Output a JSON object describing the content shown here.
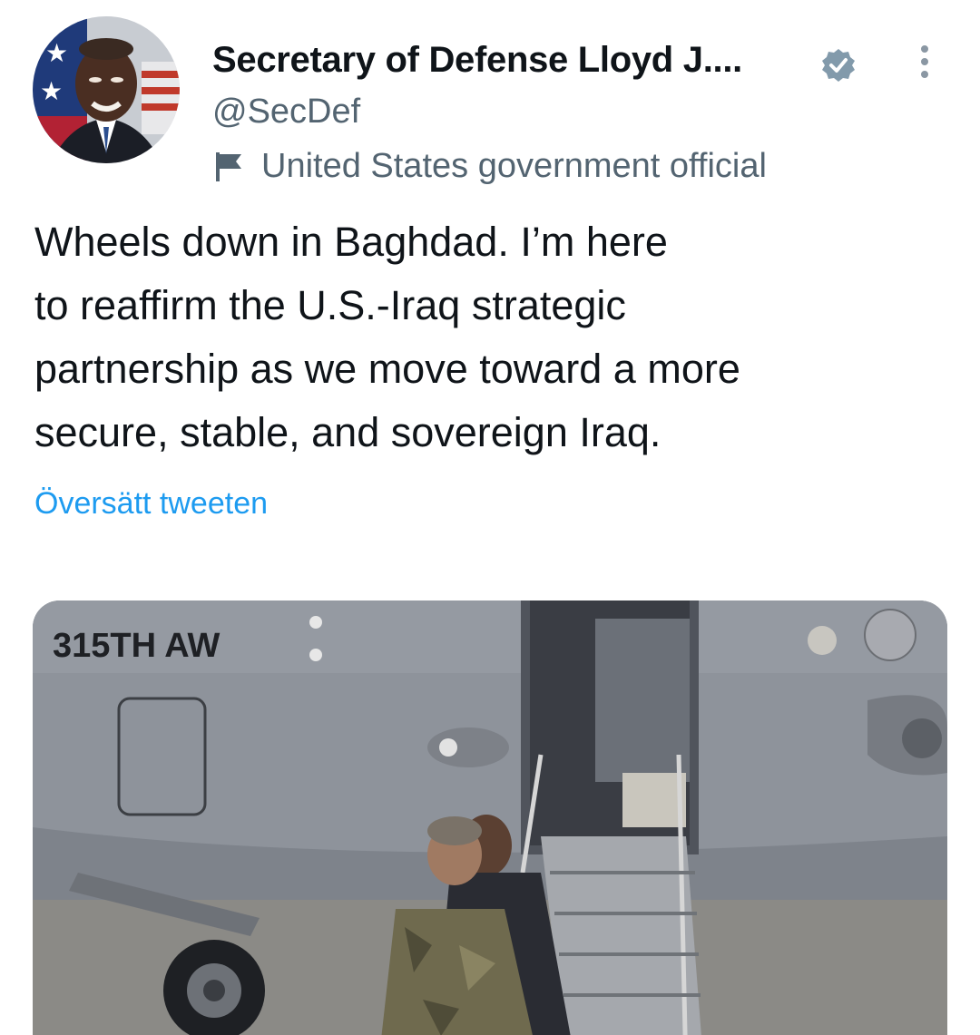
{
  "author": {
    "display_name": "Secretary of Defense Lloyd J....",
    "handle": "@SecDef",
    "label": "United States government official",
    "avatar_icon": "profile-photo",
    "verified_icon": "verified-badge-icon",
    "verified_color": "#829aab"
  },
  "tweet": {
    "lines": [
      "Wheels down in Baghdad. I’m here",
      "to reaffirm the U.S.-Iraq strategic",
      "partnership as we move toward a more",
      "secure, stable, and sovereign Iraq."
    ],
    "translate": "Översätt tweeten"
  },
  "media": {
    "aircraft_marking": "315TH AW",
    "icon": "aircraft-photo"
  },
  "colors": {
    "text_primary": "#0f1419",
    "text_secondary": "#536471",
    "link": "#1d9bf0"
  }
}
